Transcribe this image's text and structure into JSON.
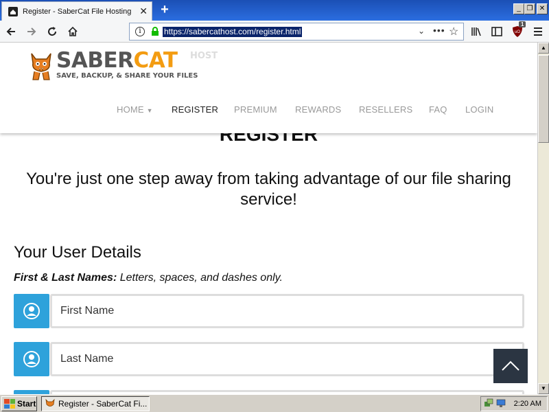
{
  "browser": {
    "tab_title": "Register - SaberCat File Hosting",
    "url": "https://sabercathost.com/register.html",
    "ublock_count": "1"
  },
  "site": {
    "logo_word_1": "SABER",
    "logo_word_2": "CAT",
    "logo_host": "HOST",
    "tagline": "SAVE, BACKUP, & SHARE YOUR FILES",
    "nav": {
      "home": "HOME",
      "register": "REGISTER",
      "premium": "PREMIUM",
      "rewards": "REWARDS",
      "resellers": "RESELLERS",
      "faq": "FAQ",
      "login": "LOGIN"
    },
    "active_nav": "REGISTER"
  },
  "page": {
    "title": "REGISTER",
    "intro": "You're just one step away from taking advantage of our file sharing service!",
    "section_heading": "Your User Details",
    "names_hint_label": "First & Last Names:",
    "names_hint_text": "Letters, spaces, and dashes only.",
    "fields": {
      "first_name_placeholder": "First Name",
      "last_name_placeholder": "Last Name"
    }
  },
  "taskbar": {
    "start_label": "Start",
    "task_label": "Register - SaberCat Fi...",
    "clock": "2:20 AM"
  },
  "colors": {
    "accent_blue": "#2ea2db",
    "logo_orange": "#f39c12",
    "back_to_top": "#2b3542"
  }
}
